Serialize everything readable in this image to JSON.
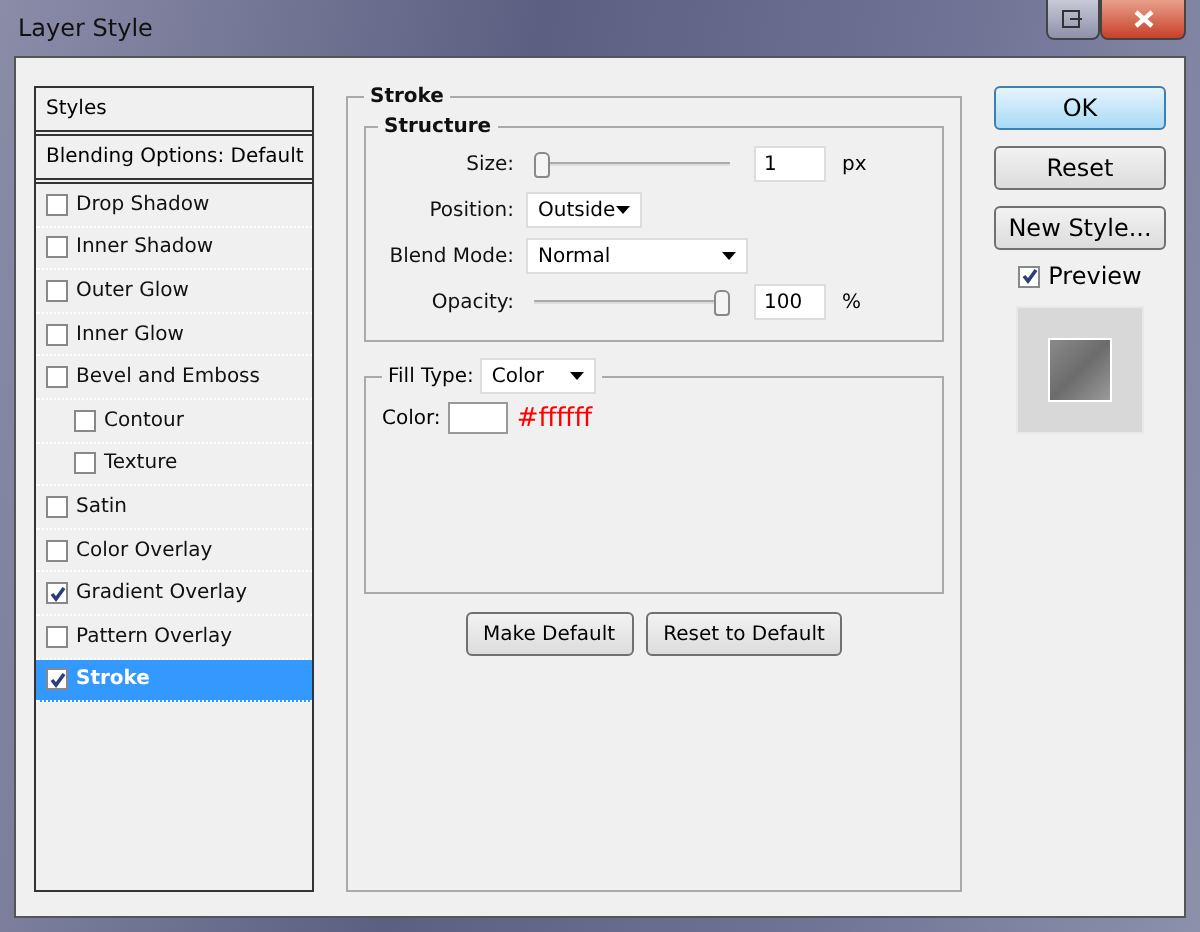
{
  "window": {
    "title": "Layer Style"
  },
  "sidebar": {
    "header": "Styles",
    "blending": "Blending Options: Default",
    "items": [
      {
        "label": "Drop Shadow",
        "checked": false,
        "selected": false
      },
      {
        "label": "Inner Shadow",
        "checked": false,
        "selected": false
      },
      {
        "label": "Outer Glow",
        "checked": false,
        "selected": false
      },
      {
        "label": "Inner Glow",
        "checked": false,
        "selected": false
      },
      {
        "label": "Bevel and Emboss",
        "checked": false,
        "selected": false,
        "children": [
          {
            "label": "Contour",
            "checked": false,
            "selected": false
          },
          {
            "label": "Texture",
            "checked": false,
            "selected": false
          }
        ]
      },
      {
        "label": "Satin",
        "checked": false,
        "selected": false
      },
      {
        "label": "Color Overlay",
        "checked": false,
        "selected": false
      },
      {
        "label": "Gradient Overlay",
        "checked": true,
        "selected": false
      },
      {
        "label": "Pattern Overlay",
        "checked": false,
        "selected": false
      },
      {
        "label": "Stroke",
        "checked": true,
        "selected": true
      }
    ]
  },
  "stroke": {
    "title": "Stroke",
    "structure": {
      "title": "Structure",
      "size": {
        "label": "Size:",
        "level": 0,
        "value": "1",
        "unit": "px"
      },
      "position": {
        "label": "Position:",
        "value": "Outside"
      },
      "blend_mode": {
        "label": "Blend Mode:",
        "value": "Normal"
      },
      "opacity": {
        "label": "Opacity:",
        "level": 1,
        "value": "100",
        "unit": "%"
      }
    },
    "fill": {
      "label": "Fill Type:",
      "value": "Color",
      "color_label": "Color:",
      "color": "#ffffff",
      "color_text": "#ffffff"
    },
    "buttons": [
      "Make Default",
      "Reset to Default"
    ]
  },
  "actions": [
    {
      "label": "OK",
      "default": true
    },
    {
      "label": "Reset",
      "default": false
    },
    {
      "label": "New Style...",
      "default": false
    }
  ],
  "preview": {
    "label": "Preview",
    "checked": true
  }
}
